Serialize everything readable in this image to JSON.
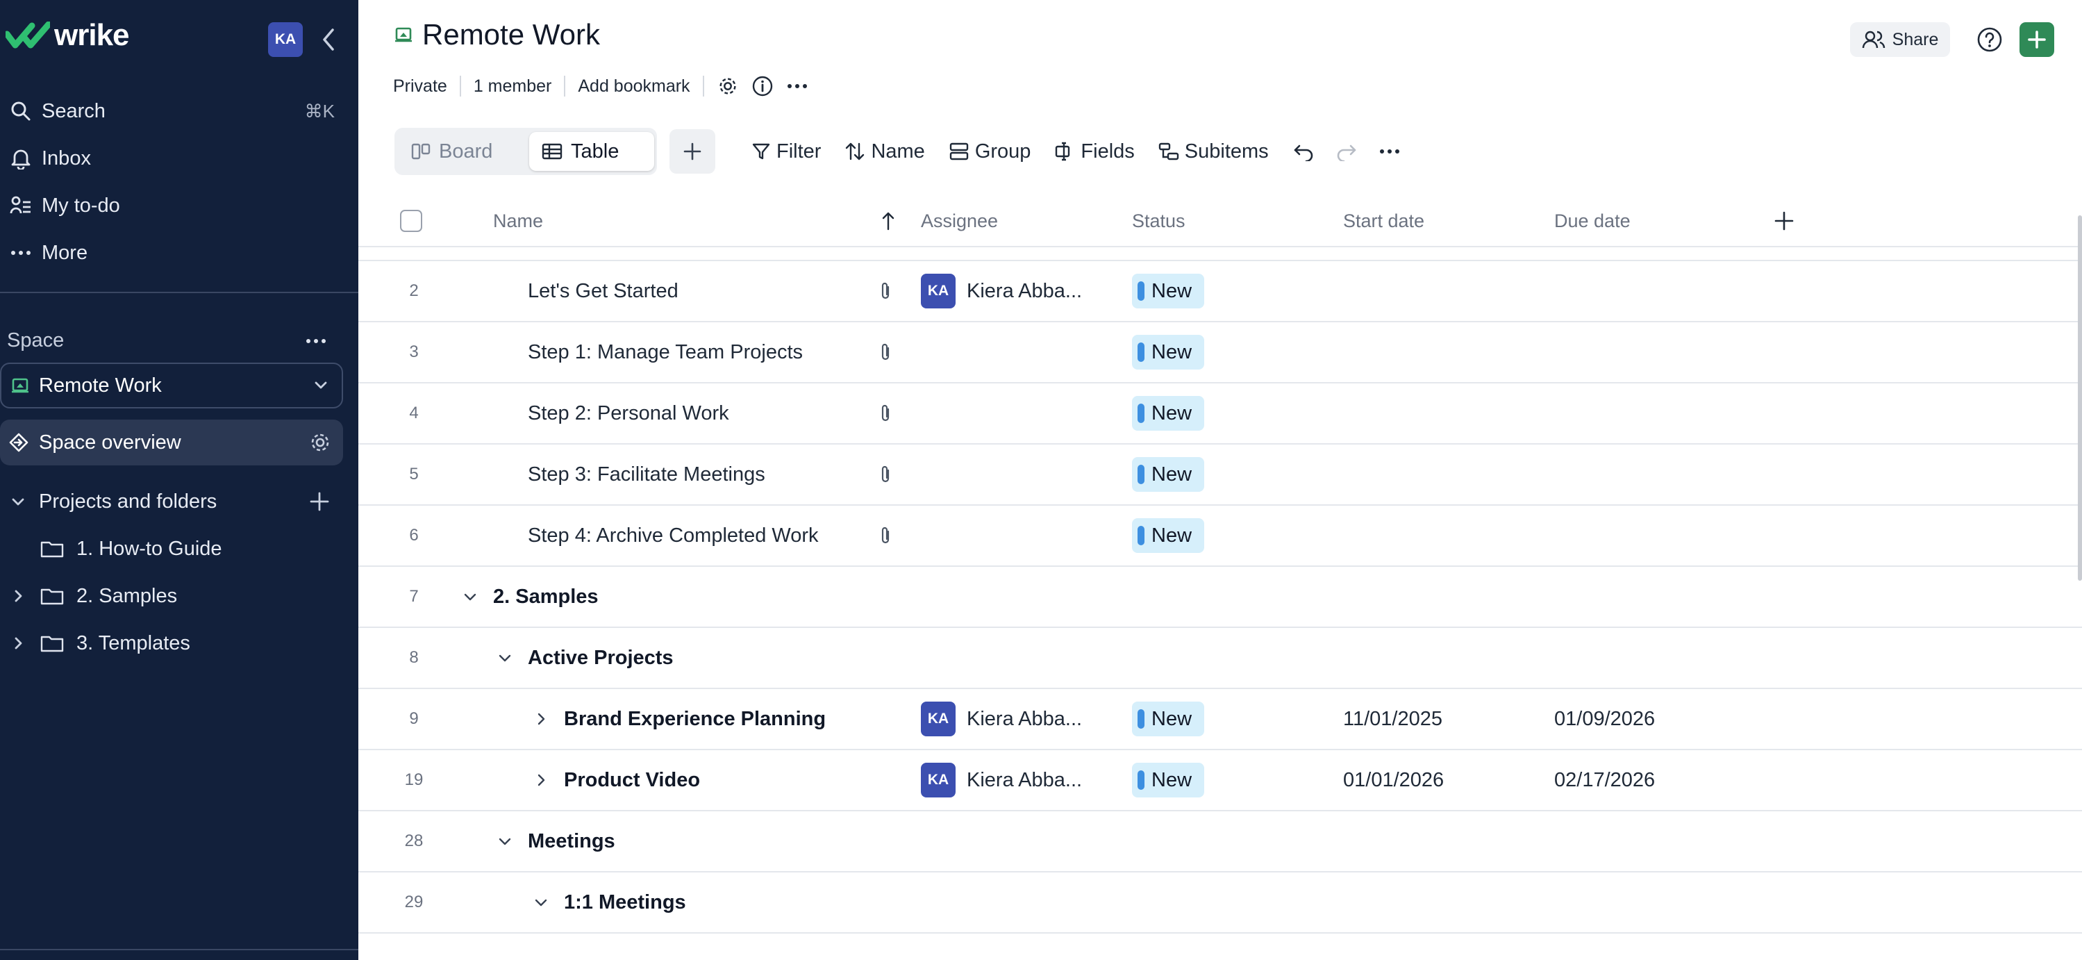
{
  "sidebar": {
    "logo_text": "wrike",
    "avatar_initials": "KA",
    "nav": [
      {
        "label": "Search",
        "shortcut": "⌘K",
        "icon": "search-icon"
      },
      {
        "label": "Inbox",
        "icon": "bell-icon"
      },
      {
        "label": "My to-do",
        "icon": "person-list-icon"
      },
      {
        "label": "More",
        "icon": "ellipsis-icon"
      }
    ],
    "space_label": "Space",
    "space_select": "Remote Work",
    "space_overview": "Space overview",
    "projects_label": "Projects and folders",
    "folders": [
      {
        "label": "1. How-to Guide"
      },
      {
        "label": "2. Samples"
      },
      {
        "label": "3. Templates"
      }
    ]
  },
  "header": {
    "title": "Remote Work",
    "meta": {
      "privacy": "Private",
      "members": "1 member",
      "bookmark": "Add bookmark"
    },
    "share_label": "Share"
  },
  "views": {
    "board": "Board",
    "table": "Table",
    "active": "Table"
  },
  "toolbar": {
    "filter": "Filter",
    "sort": "Name",
    "group": "Group",
    "fields": "Fields",
    "subitems": "Subitems"
  },
  "table": {
    "columns": {
      "name": "Name",
      "assignee": "Assignee",
      "status": "Status",
      "start": "Start date",
      "due": "Due date"
    },
    "rows": [
      {
        "num": "2",
        "name": "Let's Get Started",
        "bold": false,
        "indent": 2,
        "attachment": true,
        "assignee": "Kiera Abba...",
        "assignee_initials": "KA",
        "status": "New",
        "start": "",
        "due": ""
      },
      {
        "num": "3",
        "name": "Step 1: Manage Team Projects",
        "bold": false,
        "indent": 2,
        "attachment": true,
        "assignee": "",
        "assignee_initials": "",
        "status": "New",
        "start": "",
        "due": ""
      },
      {
        "num": "4",
        "name": "Step 2: Personal Work",
        "bold": false,
        "indent": 2,
        "attachment": true,
        "assignee": "",
        "assignee_initials": "",
        "status": "New",
        "start": "",
        "due": ""
      },
      {
        "num": "5",
        "name": "Step 3: Facilitate Meetings",
        "bold": false,
        "indent": 2,
        "attachment": true,
        "assignee": "",
        "assignee_initials": "",
        "status": "New",
        "start": "",
        "due": ""
      },
      {
        "num": "6",
        "name": "Step 4: Archive Completed Work",
        "bold": false,
        "indent": 2,
        "attachment": true,
        "assignee": "",
        "assignee_initials": "",
        "status": "New",
        "start": "",
        "due": ""
      },
      {
        "num": "7",
        "name": "2. Samples",
        "bold": true,
        "indent": 1,
        "chevron": "down",
        "assignee": "",
        "status": "",
        "start": "",
        "due": ""
      },
      {
        "num": "8",
        "name": "Active Projects",
        "bold": true,
        "indent": 2,
        "chevron": "down",
        "assignee": "",
        "status": "",
        "start": "",
        "due": ""
      },
      {
        "num": "9",
        "name": "Brand Experience Planning",
        "bold": true,
        "indent": 3,
        "chevron": "right",
        "assignee": "Kiera Abba...",
        "assignee_initials": "KA",
        "status": "New",
        "start": "11/01/2025",
        "due": "01/09/2026"
      },
      {
        "num": "19",
        "name": "Product Video",
        "bold": true,
        "indent": 3,
        "chevron": "right",
        "assignee": "Kiera Abba...",
        "assignee_initials": "KA",
        "status": "New",
        "start": "01/01/2026",
        "due": "02/17/2026"
      },
      {
        "num": "28",
        "name": "Meetings",
        "bold": true,
        "indent": 2,
        "chevron": "down",
        "assignee": "",
        "status": "",
        "start": "",
        "due": ""
      },
      {
        "num": "29",
        "name": "1:1 Meetings",
        "bold": true,
        "indent": 3,
        "chevron": "down",
        "assignee": "",
        "status": "",
        "start": "",
        "due": ""
      }
    ]
  }
}
